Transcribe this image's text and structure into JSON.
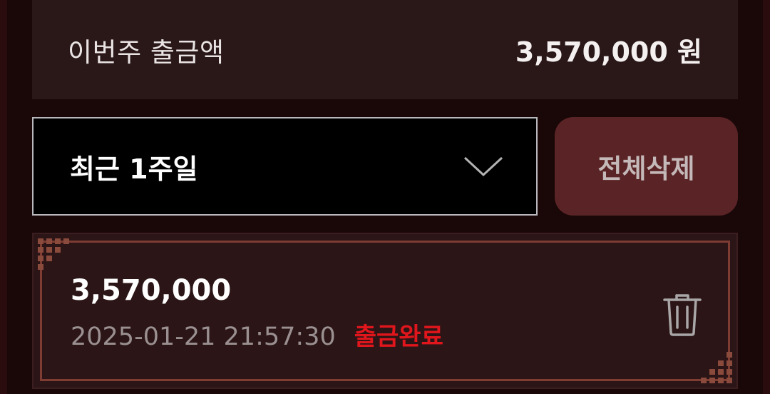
{
  "summary": {
    "label": "이번주 출금액",
    "value": "3,570,000 원"
  },
  "filter": {
    "selected": "최근 1주일",
    "icon": "chevron-down-icon"
  },
  "actions": {
    "delete_all_label": "전체삭제"
  },
  "records": [
    {
      "amount": "3,570,000",
      "datetime": "2025-01-21 21:57:30",
      "status": "출금완료",
      "delete_icon": "trash-icon"
    }
  ],
  "colors": {
    "background": "#1a0708",
    "summary_bg": "#2a1718",
    "card_bg": "#2c1516",
    "card_border": "#7e3c33",
    "delete_all_bg": "#5a2426",
    "status_complete": "#e0161c"
  }
}
